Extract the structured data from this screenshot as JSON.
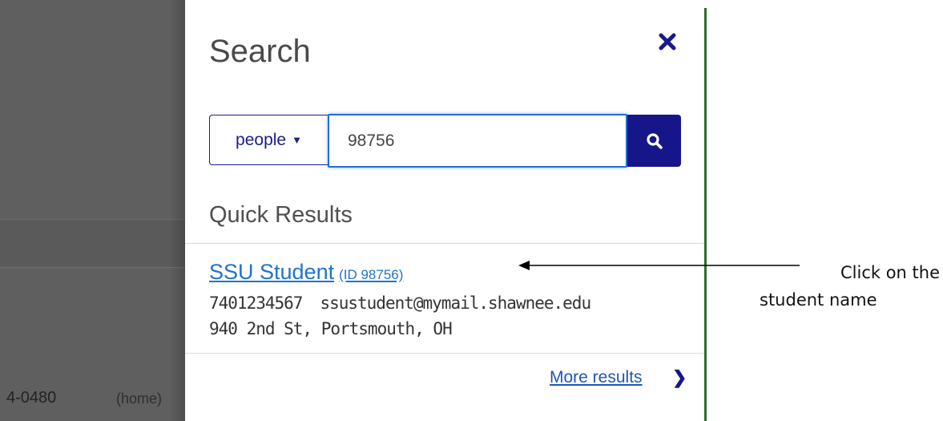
{
  "background": {
    "phone_fragment": "4-0480",
    "phone_type": "(home)"
  },
  "panel": {
    "title": "Search",
    "close_icon": "close-icon",
    "search": {
      "type_label": "people",
      "query_value": "98756",
      "search_icon": "search-icon"
    },
    "quick_results_title": "Quick Results",
    "results": [
      {
        "name": "SSU Student",
        "id_label": "(ID 98756)",
        "phone": "7401234567",
        "email": "ssustudent@mymail.shawnee.edu",
        "address": "940 2nd St, Portsmouth, OH"
      }
    ],
    "more_results_label": "More results"
  },
  "annotation": {
    "line1": "Click on the",
    "line2": "student name"
  },
  "colors": {
    "accent_navy": "#16168a",
    "link_blue": "#1f74c9",
    "focus_blue": "#1f6fd9",
    "panel_border_green": "#2e6b2e",
    "overlay_gray": "#5f5f5f"
  }
}
